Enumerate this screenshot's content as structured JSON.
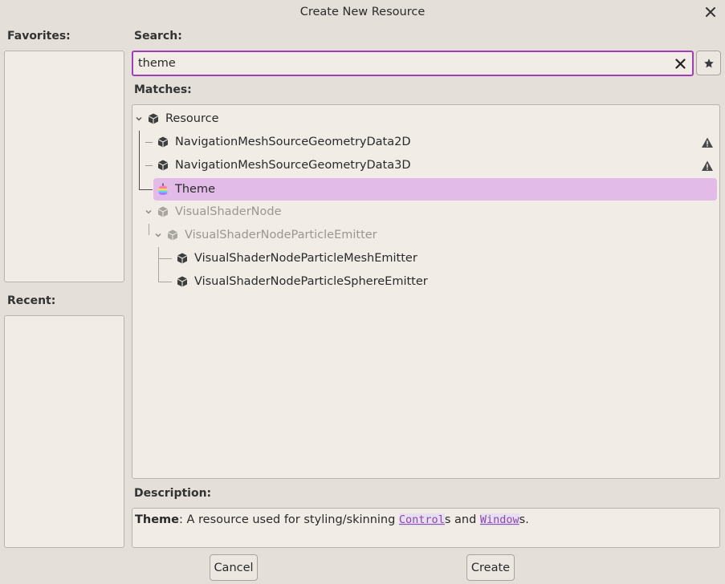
{
  "window": {
    "title": "Create New Resource"
  },
  "favorites": {
    "label": "Favorites:"
  },
  "recent": {
    "label": "Recent:"
  },
  "search": {
    "label": "Search:",
    "value": "theme"
  },
  "matches": {
    "label": "Matches:",
    "items": [
      {
        "label": "Resource",
        "icon": "resource-icon"
      },
      {
        "label": "NavigationMeshSourceGeometryData2D",
        "icon": "resource-icon",
        "warning": true
      },
      {
        "label": "NavigationMeshSourceGeometryData3D",
        "icon": "resource-icon",
        "warning": true
      },
      {
        "label": "Theme",
        "icon": "theme-icon",
        "selected": true
      },
      {
        "label": "VisualShaderNode",
        "icon": "resource-icon",
        "dimmed": true
      },
      {
        "label": "VisualShaderNodeParticleEmitter",
        "icon": "resource-icon",
        "dimmed": true
      },
      {
        "label": "VisualShaderNodeParticleMeshEmitter",
        "icon": "resource-icon"
      },
      {
        "label": "VisualShaderNodeParticleSphereEmitter",
        "icon": "resource-icon"
      }
    ]
  },
  "description": {
    "label": "Description:",
    "class_name": "Theme",
    "text_before": ": A resource used for styling/skinning ",
    "link1": "Control",
    "text_mid": "s and ",
    "link2": "Window",
    "text_after": "s."
  },
  "buttons": {
    "cancel": "Cancel",
    "create": "Create"
  },
  "colors": {
    "accent": "#a23db8",
    "selection": "#e3bbe9",
    "background": "#e4dfd8",
    "panel": "#f1ece6"
  }
}
